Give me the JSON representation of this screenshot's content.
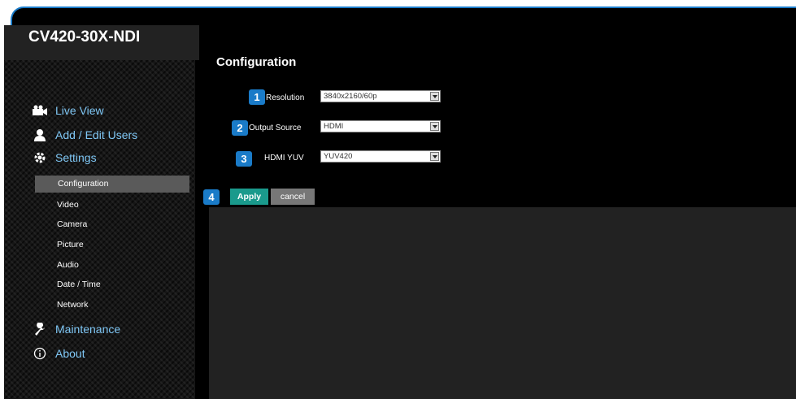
{
  "model": "CV420-30X-NDI",
  "page_title": "Configuration",
  "nav": {
    "live_view": "Live View",
    "add_edit_users": "Add / Edit Users",
    "settings": "Settings",
    "sub_items": [
      "Configuration",
      "Video",
      "Camera",
      "Picture",
      "Audio",
      "Date / Time",
      "Network"
    ],
    "maintenance": "Maintenance",
    "about": "About"
  },
  "fields": [
    {
      "badge": "1",
      "label": "Resolution",
      "value": "3840x2160/60p"
    },
    {
      "badge": "2",
      "label": "Output Source",
      "value": "HDMI"
    },
    {
      "badge": "3",
      "label": "HDMI YUV",
      "value": "YUV420"
    }
  ],
  "actions": {
    "badge": "4",
    "apply": "Apply",
    "cancel": "cancel"
  },
  "colors": {
    "accent": "#1a7bc8",
    "apply": "#1a9a8c",
    "nav_text": "#7fc7f5"
  },
  "icons": {
    "live_view": "camera-icon",
    "users": "user-icon",
    "settings": "gear-icon",
    "maintenance": "wrench-icon",
    "about": "info-icon"
  }
}
